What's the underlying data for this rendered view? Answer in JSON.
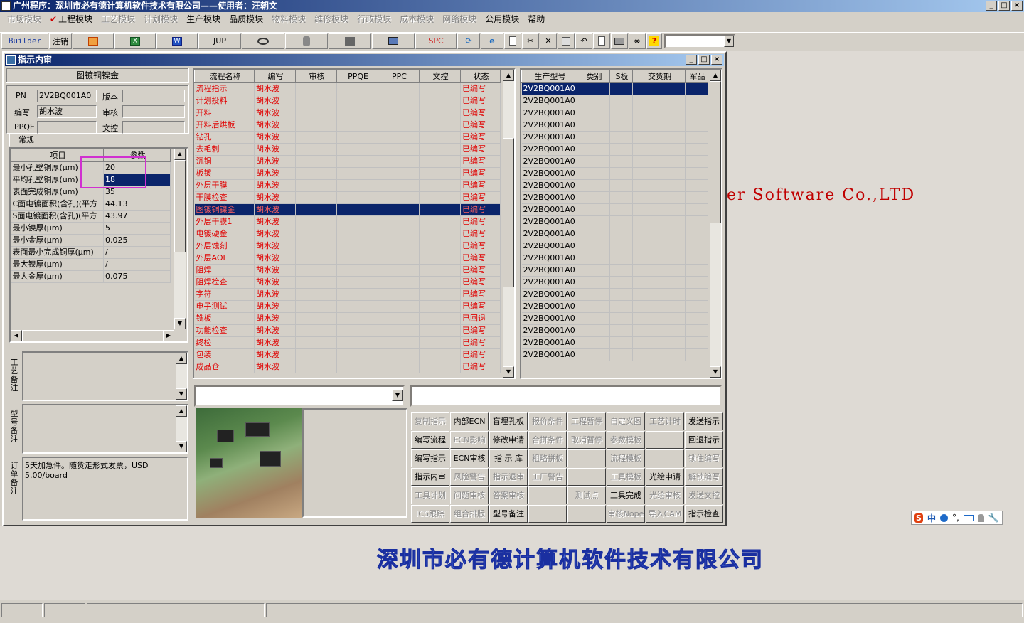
{
  "window": {
    "title": "广州程序：深圳市必有德计算机软件技术有限公司——使用者：汪朝文",
    "controls": [
      "_",
      "□",
      "×"
    ]
  },
  "menu": [
    {
      "label": "市场模块",
      "disabled": true
    },
    {
      "label": "工程模块",
      "disabled": false,
      "checked": true
    },
    {
      "label": "工艺模块",
      "disabled": true
    },
    {
      "label": "计划模块",
      "disabled": true
    },
    {
      "label": "生产模块",
      "disabled": false
    },
    {
      "label": "品质模块",
      "disabled": false
    },
    {
      "label": "物料模块",
      "disabled": true
    },
    {
      "label": "维修模块",
      "disabled": true
    },
    {
      "label": "行政模块",
      "disabled": true
    },
    {
      "label": "成本模块",
      "disabled": true
    },
    {
      "label": "网络模块",
      "disabled": true
    },
    {
      "label": "公用模块",
      "disabled": false
    },
    {
      "label": "帮助",
      "disabled": false
    }
  ],
  "toolbar": {
    "builder": "Builder",
    "logout": "注销",
    "jup": "JUP",
    "spc": "SPC",
    "icons": [
      "powerpoint-icon",
      "excel-icon",
      "word-icon",
      "eye-icon",
      "database-icon",
      "network-icon",
      "monitor-icon",
      "refresh-icon",
      "ie-icon",
      "new-icon",
      "cut-icon",
      "delete-icon",
      "save-icon",
      "undo-icon",
      "preview-icon",
      "print-icon",
      "find-icon",
      "help-icon"
    ],
    "combo_value": ""
  },
  "desktop": {
    "company_en": "er Software Co.,LTD",
    "company_cn": "深圳市必有德计算机软件技术有限公司"
  },
  "ime": {
    "s": "S",
    "zh": "中",
    "punct": "°,"
  },
  "subwindow": {
    "title": "指示内审",
    "heading": "图镀铜镍金",
    "pn_label": "PN",
    "pn_value": "2V2BQ001A0",
    "version_label": "版本",
    "version_value": "",
    "author_label": "编写",
    "author_value": "胡水波",
    "review_label": "审核",
    "review_value": "",
    "ppqe_label": "PPQE",
    "ppqe_value": "",
    "doc_label": "文控",
    "doc_value": "",
    "tab_label": "常规",
    "param_headers": [
      "项目",
      "参数"
    ],
    "params": [
      [
        "最小孔壁铜厚(μm)",
        "20"
      ],
      [
        "平均孔壁铜厚(um)",
        "18"
      ],
      [
        "表面完成铜厚(um)",
        "35"
      ],
      [
        "C面电镀面积(含孔)(平方",
        "44.13"
      ],
      [
        "S面电镀面积(含孔)(平方",
        "43.97"
      ],
      [
        "最小镍厚(μm)",
        "5"
      ],
      [
        "最小金厚(μm)",
        "0.025"
      ],
      [
        "表面最小完成铜厚(μm)",
        "/"
      ],
      [
        "最大镍厚(μm)",
        "/"
      ],
      [
        "最大金厚(μm)",
        "0.075"
      ]
    ],
    "note_labels": {
      "process": "工艺备注",
      "model": "型号备注",
      "order": "订单备注"
    },
    "order_note": "5天加急件。随货走形式发票，USD 5.00/board",
    "flow_headers": [
      "流程名称",
      "编写",
      "审核",
      "PPQE",
      "PPC",
      "文控",
      "状态"
    ],
    "flow_rows": [
      [
        "流程指示",
        "胡水波",
        "已编写"
      ],
      [
        "计划投料",
        "胡水波",
        "已编写"
      ],
      [
        "开料",
        "胡水波",
        "已编写"
      ],
      [
        "开料后烘板",
        "胡水波",
        "已编写"
      ],
      [
        "钻孔",
        "胡水波",
        "已编写"
      ],
      [
        "去毛刺",
        "胡水波",
        "已编写"
      ],
      [
        "沉铜",
        "胡水波",
        "已编写"
      ],
      [
        "板镀",
        "胡水波",
        "已编写"
      ],
      [
        "外层干膜",
        "胡水波",
        "已编写"
      ],
      [
        "干膜检查",
        "胡水波",
        "已编写"
      ],
      [
        "图镀铜镍金",
        "胡水波",
        "已编写"
      ],
      [
        "外层干膜1",
        "胡水波",
        "已编写"
      ],
      [
        "电镀硬金",
        "胡水波",
        "已编写"
      ],
      [
        "外层蚀刻",
        "胡水波",
        "已编写"
      ],
      [
        "外层AOI",
        "胡水波",
        "已编写"
      ],
      [
        "阻焊",
        "胡水波",
        "已编写"
      ],
      [
        "阻焊检查",
        "胡水波",
        "已编写"
      ],
      [
        "字符",
        "胡水波",
        "已编写"
      ],
      [
        "电子测试",
        "胡水波",
        "已编写"
      ],
      [
        "铣板",
        "胡水波",
        "已回退"
      ],
      [
        "功能检查",
        "胡水波",
        "已编写"
      ],
      [
        "终检",
        "胡水波",
        "已编写"
      ],
      [
        "包装",
        "胡水波",
        "已编写"
      ],
      [
        "成品仓",
        "胡水波",
        "已编写"
      ]
    ],
    "model_headers": [
      "生产型号",
      "类别",
      "S板",
      "交货期",
      "军品"
    ],
    "model_rows": [
      "2V2BQ001A0",
      "2V2BQ001A0",
      "2V2BQ001A0",
      "2V2BQ001A0",
      "2V2BQ001A0",
      "2V2BQ001A0",
      "2V2BQ001A0",
      "2V2BQ001A0",
      "2V2BQ001A0",
      "2V2BQ001A0",
      "2V2BQ001A0",
      "2V2BQ001A0",
      "2V2BQ001A0",
      "2V2BQ001A0",
      "2V2BQ001A0",
      "2V2BQ001A0",
      "2V2BQ001A0",
      "2V2BQ001A0",
      "2V2BQ001A0",
      "2V2BQ001A0",
      "2V2BQ001A0",
      "2V2BQ001A0",
      "2V2BQ001A0"
    ],
    "actions": [
      {
        "label": "复制指示",
        "disabled": true
      },
      {
        "label": "内部ECN",
        "disabled": false
      },
      {
        "label": "盲埋孔板",
        "disabled": false
      },
      {
        "label": "报价条件",
        "disabled": true
      },
      {
        "label": "工程暂停",
        "disabled": true
      },
      {
        "label": "自定义图",
        "disabled": true
      },
      {
        "label": "工艺计时",
        "disabled": true
      },
      {
        "label": "发送指示",
        "disabled": false
      },
      {
        "label": "编写流程",
        "disabled": false
      },
      {
        "label": "ECN影响",
        "disabled": true
      },
      {
        "label": "修改申请",
        "disabled": false
      },
      {
        "label": "合拼条件",
        "disabled": true
      },
      {
        "label": "取消暂停",
        "disabled": true
      },
      {
        "label": "参数模板",
        "disabled": true
      },
      {
        "label": "",
        "disabled": true
      },
      {
        "label": "回退指示",
        "disabled": false
      },
      {
        "label": "编写指示",
        "disabled": false
      },
      {
        "label": "ECN审核",
        "disabled": false
      },
      {
        "label": "指 示 库",
        "disabled": false
      },
      {
        "label": "粗略拼板",
        "disabled": true
      },
      {
        "label": "",
        "disabled": true
      },
      {
        "label": "流程模板",
        "disabled": true
      },
      {
        "label": "",
        "disabled": true
      },
      {
        "label": "锁住编写",
        "disabled": true
      },
      {
        "label": "指示内审",
        "disabled": false
      },
      {
        "label": "风险警告",
        "disabled": true
      },
      {
        "label": "指示退审",
        "disabled": true
      },
      {
        "label": "工厂警告",
        "disabled": true
      },
      {
        "label": "",
        "disabled": true
      },
      {
        "label": "工具模板",
        "disabled": true
      },
      {
        "label": "光绘申请",
        "disabled": false
      },
      {
        "label": "解锁编写",
        "disabled": true
      },
      {
        "label": "工具计划",
        "disabled": true
      },
      {
        "label": "问题审核",
        "disabled": true
      },
      {
        "label": "答案审核",
        "disabled": true
      },
      {
        "label": "",
        "disabled": true
      },
      {
        "label": "测试点",
        "disabled": true
      },
      {
        "label": "工具完成",
        "disabled": false
      },
      {
        "label": "光绘审核",
        "disabled": true
      },
      {
        "label": "发送文控",
        "disabled": true
      },
      {
        "label": "ICS跟踪",
        "disabled": true
      },
      {
        "label": "组合排版",
        "disabled": true
      },
      {
        "label": "型号备注",
        "disabled": false
      },
      {
        "label": "",
        "disabled": true
      },
      {
        "label": "",
        "disabled": true
      },
      {
        "label": "审核Nope",
        "disabled": true
      },
      {
        "label": "导入CAM",
        "disabled": true
      },
      {
        "label": "指示检查",
        "disabled": false
      }
    ]
  }
}
